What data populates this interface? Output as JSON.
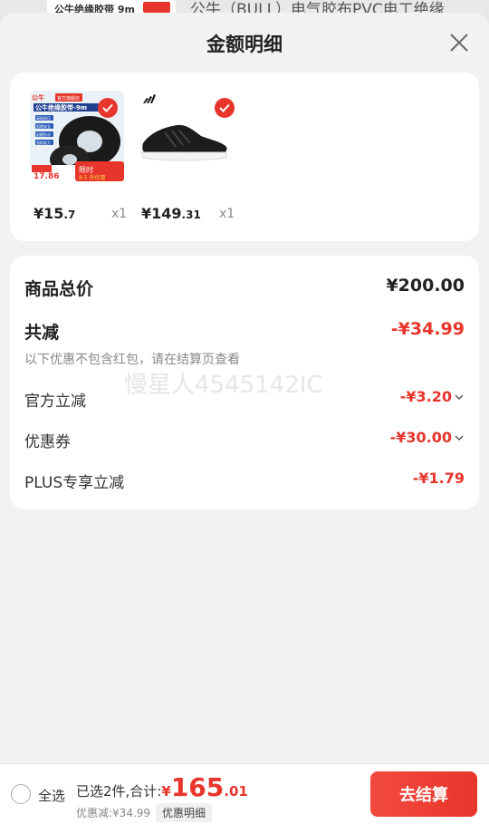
{
  "backdrop": {
    "thumb_text": "公牛绝缘胶带 9m",
    "title": "公牛（BULL）电气胶布PVC电工绝缘"
  },
  "sheet": {
    "title": "金额明细"
  },
  "products": [
    {
      "price_main": "¥15",
      "price_dec": ".7",
      "qty": "x1",
      "image_brand": "公牛",
      "image_flag": "官方旗舰店",
      "image_title": "公牛绝缘胶带-9m",
      "image_features": [
        "高粘耐压",
        "阻燃安全",
        "耐磨防水",
        "强粘粘力"
      ],
      "image_promo": "限时",
      "image_promo2": "8.5 折优惠",
      "image_price": "17.86"
    },
    {
      "price_main": "¥149",
      "price_dec": ".31",
      "qty": "x1"
    }
  ],
  "summary": {
    "total_label": "商品总价",
    "total_value": "¥200.00",
    "reduce_label": "共减",
    "reduce_value": "-¥34.99",
    "note": "以下优惠不包含红包，请在结算页查看",
    "items": [
      {
        "label": "官方立减",
        "value": "-¥3.20"
      },
      {
        "label": "优惠券",
        "value": "-¥30.00"
      },
      {
        "label": "PLUS专享立减",
        "value": "-¥1.79"
      }
    ]
  },
  "watermark": "慢星人4545142IC",
  "bottom": {
    "select_all": "全选",
    "selected_text": "已选2件,合计:",
    "currency": "¥",
    "total_int": "165",
    "total_dec": ".01",
    "discount_text": "优惠减:¥34.99",
    "detail_label": "优惠明细",
    "checkout_label": "去结算"
  },
  "colors": {
    "accent": "#e8352c",
    "sheet_bg": "#f2f2f2",
    "card_bg": "#ffffff"
  },
  "icons": {
    "close": "close-icon",
    "check": "check-icon",
    "chevron": "chevron-down-icon",
    "adidas": "adidas-logo-icon"
  }
}
